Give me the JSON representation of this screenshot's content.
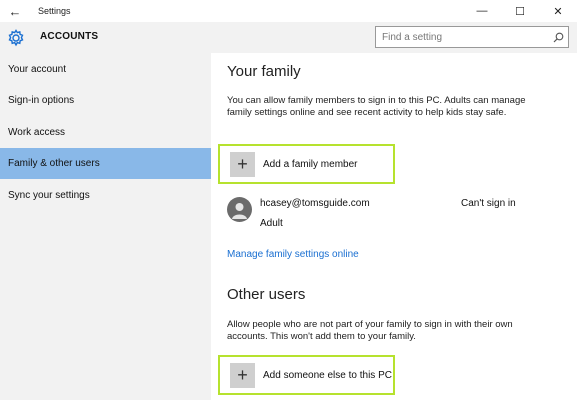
{
  "window": {
    "title": "Settings",
    "back_glyph": "←",
    "minimize_glyph": "—",
    "maximize_glyph": "☐",
    "close_glyph": "✕"
  },
  "header": {
    "title": "ACCOUNTS",
    "icon": "gear-icon",
    "search_placeholder": "Find a setting",
    "accent_color": "#1a6fd1"
  },
  "sidebar": {
    "items": [
      {
        "label": "Your account",
        "selected": false
      },
      {
        "label": "Sign-in options",
        "selected": false
      },
      {
        "label": "Work access",
        "selected": false
      },
      {
        "label": "Family & other users",
        "selected": true
      },
      {
        "label": "Sync your settings",
        "selected": false
      }
    ],
    "selected_color": "#89b8e8"
  },
  "family": {
    "heading": "Your family",
    "description": "You can allow family members to sign in to this PC. Adults can manage family settings online and see recent activity to help kids stay safe.",
    "add_label": "Add a family member",
    "member": {
      "email": "hcasey@tomsguide.com",
      "role": "Adult",
      "status": "Can't sign in"
    },
    "manage_link": "Manage family settings online"
  },
  "other_users": {
    "heading": "Other users",
    "description": "Allow people who are not part of your family to sign in with their own accounts. This won't add them to your family.",
    "add_label": "Add someone else to this PC"
  },
  "highlight_color": "#b6e22e"
}
